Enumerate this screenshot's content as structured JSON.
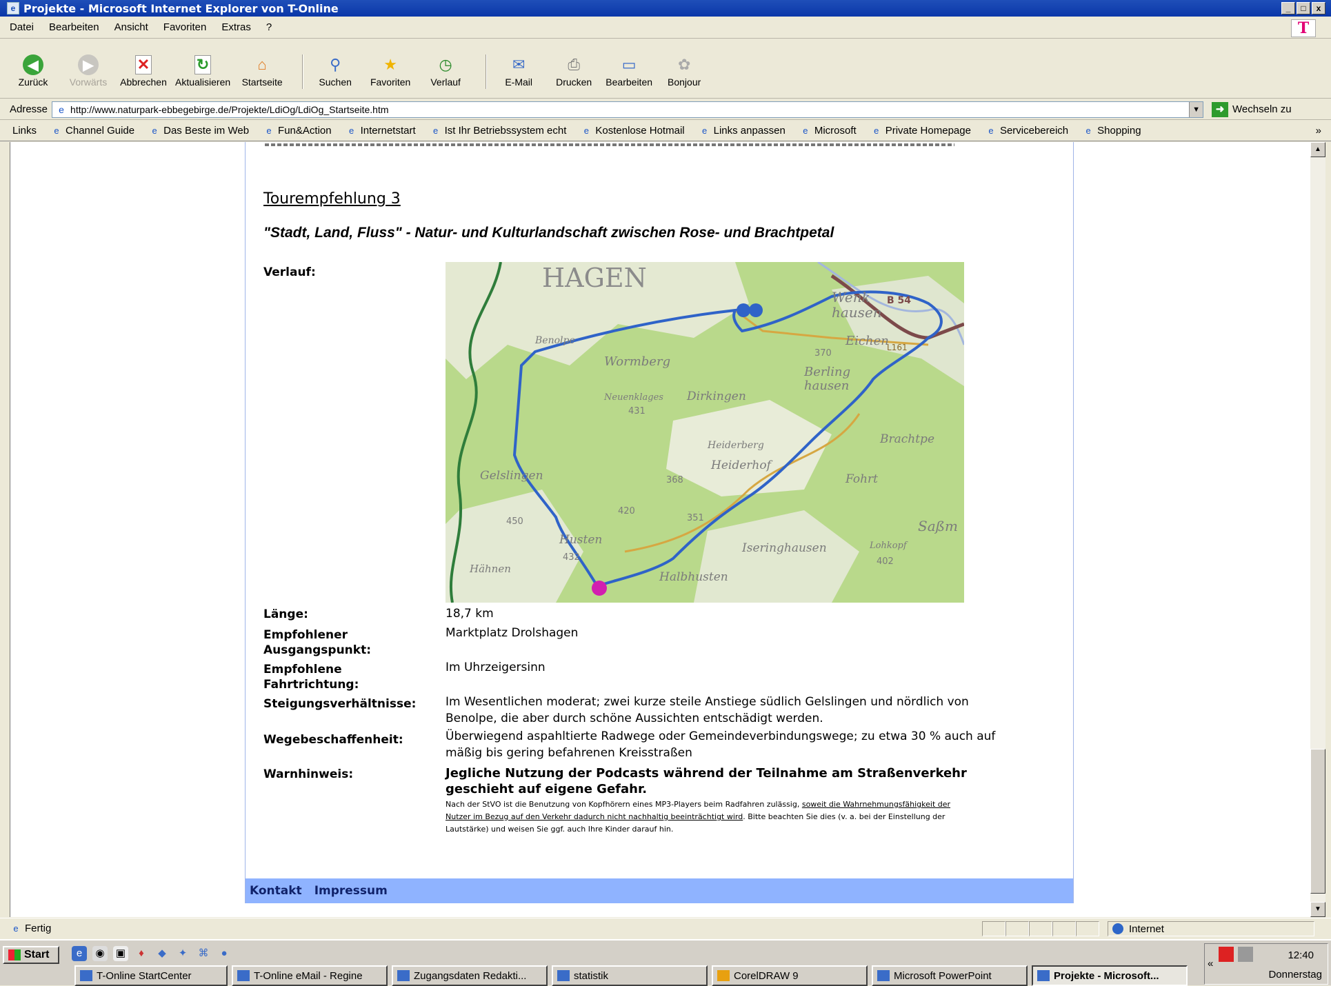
{
  "window": {
    "title": "Projekte - Microsoft Internet Explorer von T-Online",
    "minimize": "_",
    "maximize": "□",
    "close": "x"
  },
  "menu": {
    "items": [
      "Datei",
      "Bearbeiten",
      "Ansicht",
      "Favoriten",
      "Extras",
      "?"
    ],
    "brand_logo": "T"
  },
  "toolbar": {
    "back": "Zurück",
    "forward": "Vorwärts",
    "stop": "Abbrechen",
    "refresh": "Aktualisieren",
    "home": "Startseite",
    "search": "Suchen",
    "favorites": "Favoriten",
    "history": "Verlauf",
    "mail": "E-Mail",
    "print": "Drucken",
    "edit": "Bearbeiten",
    "bonjour": "Bonjour"
  },
  "address": {
    "label": "Adresse",
    "url": "http://www.naturpark-ebbegebirge.de/Projekte/LdiOg/LdiOg_Startseite.htm",
    "go_label": "Wechseln zu"
  },
  "links": {
    "label": "Links",
    "items": [
      "Channel Guide",
      "Das Beste im Web",
      "Fun&Action",
      "Internetstart",
      "Ist Ihr Betriebssystem echt",
      "Kostenlose Hotmail",
      "Links anpassen",
      "Microsoft",
      "Private Homepage",
      "Servicebereich",
      "Shopping"
    ],
    "more": "»"
  },
  "content": {
    "heading": "Tourempfehlung 3",
    "subtitle": "\"Stadt, Land, Fluss\" - Natur- und Kulturlandschaft zwischen Rose- und Brachtpetal",
    "verlauf_label": "Verlauf:",
    "map_labels": {
      "hagen": "HAGEN",
      "wenkhausen_1": "Wenk",
      "wenkhausen_2": "hausen",
      "eichen": "Eichen",
      "berlinghausen_1": "Berling",
      "berlinghausen_2": "hausen",
      "wormberg": "Wormberg",
      "benolpe": "Benolpe",
      "neuenklages": "Neuenklages",
      "dirkingen": "Dirkingen",
      "heiderberg": "Heiderberg",
      "heiderhof": "Heiderhof",
      "brachtpe": "Brachtpe",
      "fohrt": "Fohrt",
      "gelslingen": "Gelslingen",
      "husten": "Husten",
      "iseringhausen": "Iseringhausen",
      "hahnen": "Hähnen",
      "halbhusten": "Halbhusten",
      "sassm": "Saßm",
      "lohkopf": "Lohkopf",
      "n402": "402",
      "n432": "432",
      "n368": "368",
      "n420": "420",
      "n351": "351",
      "n431": "431",
      "n370": "370",
      "n450": "450",
      "b54": "B 54",
      "l161": "L161"
    },
    "rows": [
      {
        "label": "Länge:",
        "value": "18,7 km"
      },
      {
        "label": "Empfohlener Ausgangspunkt:",
        "value": "Marktplatz Drolshagen"
      },
      {
        "label": "Empfohlene Fahrtrichtung:",
        "value": "Im Uhrzeigersinn"
      },
      {
        "label": "Steigungsverhältnisse:",
        "value": "Im Wesentlichen moderat; zwei kurze steile Anstiege südlich Gelslingen und nördlich von Benolpe, die aber durch schöne Aussichten entschädigt werden."
      },
      {
        "label": "Wegebeschaffenheit:",
        "value": "Überwiegend aspahltierte Radwege oder Gemeindeverbindungswege; zu etwa 30 % auch auf mäßig bis gering befahrenen Kreisstraßen"
      },
      {
        "label": "Warnhinweis:",
        "value": ""
      }
    ],
    "warning_bold": "Jegliche Nutzung der Podcasts während der Teilnahme am Straßenverkehr geschieht auf eigene Gefahr.",
    "warning_small_1": "Nach der StVO ist die Benutzung von Kopfhörern eines MP3-Players beim Radfahren zulässig,",
    "warning_small_link": "soweit die Wahrnehmungsfähigkeit der Nutzer im Bezug auf den Verkehr dadurch nicht nachhaltig beeinträchtigt wird",
    "warning_small_2": ". Bitte beachten Sie dies (v. a. bei der Einstellung der Lautstärke) und weisen Sie ggf. auch Ihre Kinder darauf hin.",
    "footer": {
      "kontakt": "Kontakt",
      "impressum": "Impressum"
    }
  },
  "status": {
    "text": "Fertig",
    "zone": "Internet"
  },
  "taskbar": {
    "start": "Start",
    "buttons": [
      "T-Online StartCenter",
      "T-Online eMail - Regine",
      "Zugangsdaten Redakti...",
      "statistik",
      "CorelDRAW 9",
      "Microsoft PowerPoint",
      "Projekte - Microsoft..."
    ],
    "clock": "12:40",
    "day": "Donnerstag",
    "chevron": "«"
  },
  "colors": {
    "titlebar": "#0a37a8",
    "footer_bar": "#8fb3ff",
    "route": "#2f63c8",
    "map_green": "#b9d98b"
  }
}
